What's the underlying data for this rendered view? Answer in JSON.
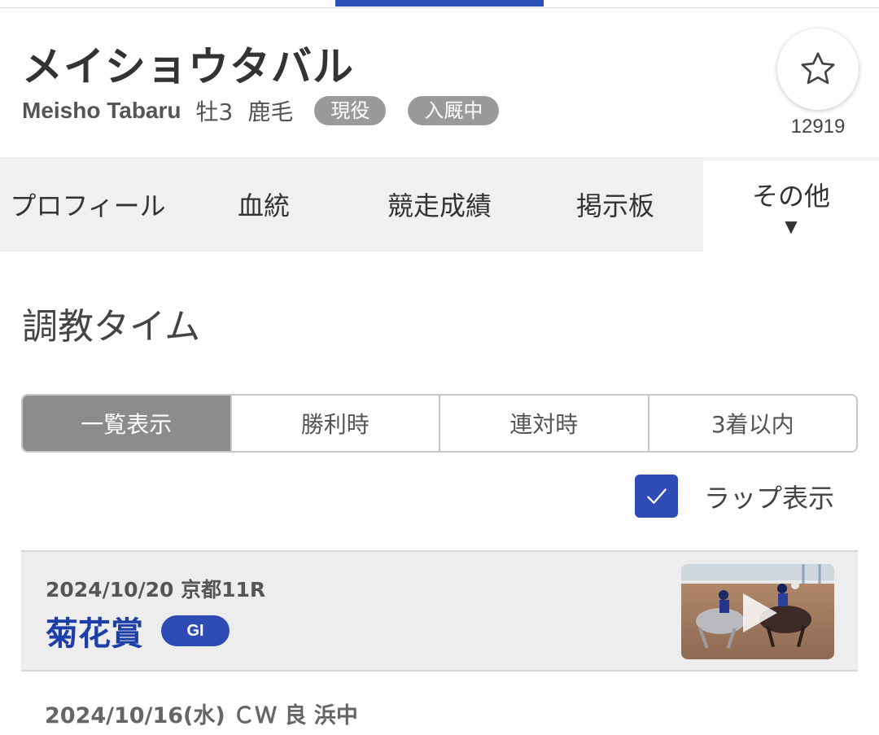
{
  "horse": {
    "name_ja": "メイショウタバル",
    "name_en": "Meisho Tabaru",
    "sex_age": "牡3",
    "coat": "鹿毛",
    "badges": [
      "現役",
      "入厩中"
    ],
    "favorite_count": "12919"
  },
  "tabs": [
    {
      "label": "プロフィール"
    },
    {
      "label": "血統"
    },
    {
      "label": "競走成績"
    },
    {
      "label": "掲示板"
    },
    {
      "label": "その他",
      "caret": "▼"
    }
  ],
  "section": {
    "title": "調教タイム"
  },
  "filters": {
    "options": [
      "一覧表示",
      "勝利時",
      "連対時",
      "3着以内"
    ],
    "selected": "一覧表示"
  },
  "lap_toggle": {
    "label": "ラップ表示",
    "checked": true
  },
  "race": {
    "date_course": "2024/10/20 京都11R",
    "name": "菊花賞",
    "grade": "GI"
  },
  "training_entry": {
    "header": "2024/10/16(水) ＣＷ 良 浜中"
  },
  "colors": {
    "accent": "#2f4bb5",
    "race_link": "#1e3ea8",
    "pill_gray": "#9a9a9a",
    "segment_active": "#8c8c8c"
  },
  "icons": {
    "favorite": "star-outline-icon",
    "thumbnail_play": "play-icon",
    "checkbox": "check-icon"
  }
}
